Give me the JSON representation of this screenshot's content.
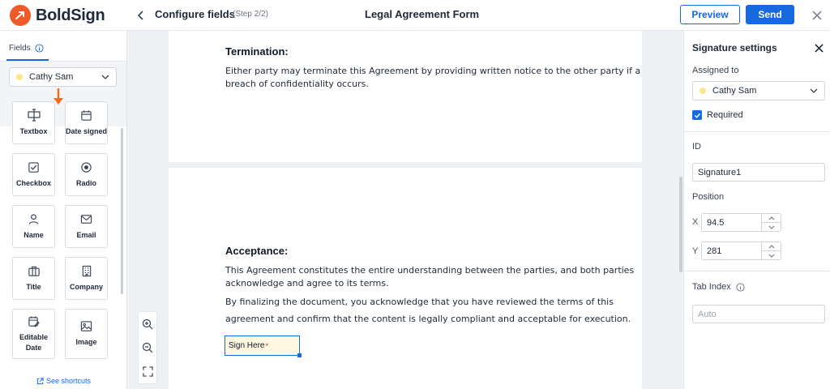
{
  "app": {
    "brand": "BoldSign",
    "accent": "#1769e0",
    "brand_color": "#f05a28"
  },
  "header": {
    "title": "Configure fields",
    "step": "(Step 2/2)",
    "document_title": "Legal Agreement Form",
    "preview_label": "Preview",
    "send_label": "Send"
  },
  "sidebar": {
    "tab_label": "Fields",
    "signer": "Cathy Sam",
    "fields": [
      {
        "label": "Textbox",
        "icon": "textbox-icon"
      },
      {
        "label": "Date signed",
        "icon": "calendar-icon"
      },
      {
        "label": "Checkbox",
        "icon": "checkbox-icon"
      },
      {
        "label": "Radio",
        "icon": "radio-icon"
      },
      {
        "label": "Name",
        "icon": "person-icon"
      },
      {
        "label": "Email",
        "icon": "envelope-icon"
      },
      {
        "label": "Title",
        "icon": "briefcase-icon"
      },
      {
        "label": "Company",
        "icon": "building-icon"
      },
      {
        "label": "Editable Date",
        "icon": "edit-calendar-icon"
      },
      {
        "label": "Image",
        "icon": "image-icon"
      }
    ],
    "shortcuts_label": "See shortcuts"
  },
  "document": {
    "termination_heading": "Termination:",
    "termination_line1": "Either party may terminate this Agreement by providing written notice to the other party if a",
    "termination_line2": "breach of confidentiality occurs.",
    "acceptance_heading": "Acceptance:",
    "acceptance_line1": "This Agreement constitutes the entire understanding between the parties, and both parties",
    "acceptance_line2": "acknowledge and agree to its terms.",
    "acceptance_line3": "By finalizing the document, you acknowledge that you have reviewed the terms of this",
    "acceptance_line4": "agreement and confirm that the content is legally compliant and acceptable for execution.",
    "sign_field_label": "Sign Here",
    "sign_field_required_mark": "*"
  },
  "settings": {
    "title": "Signature settings",
    "assigned_to_label": "Assigned to",
    "assigned_to_value": "Cathy Sam",
    "required_label": "Required",
    "id_label": "ID",
    "id_value": "Signature1",
    "position_label": "Position",
    "x_label": "X",
    "x_value": "94.5",
    "y_label": "Y",
    "y_value": "281",
    "tab_index_label": "Tab Index",
    "tab_index_placeholder": "Auto"
  }
}
